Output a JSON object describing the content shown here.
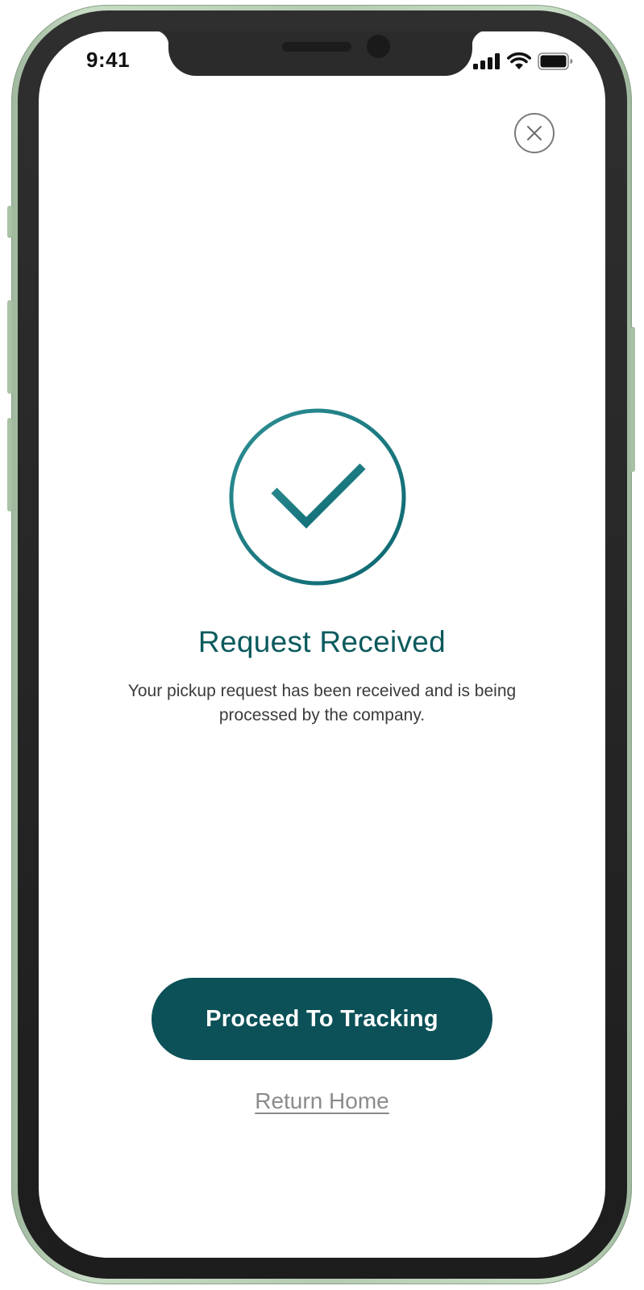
{
  "status_bar": {
    "time": "9:41",
    "signal_icon": "cellular-signal-icon",
    "wifi_icon": "wifi-icon",
    "battery_icon": "battery-icon"
  },
  "header": {
    "close_icon": "close-icon"
  },
  "confirmation": {
    "icon": "checkmark-circle-icon",
    "title": "Request Received",
    "message": "Your pickup request has been received and is being processed by the company."
  },
  "actions": {
    "primary_label": "Proceed To Tracking",
    "secondary_label": "Return Home"
  },
  "colors": {
    "accent": "#0b5157",
    "title": "#0b5a5d",
    "frame": "#b4cbb1"
  }
}
